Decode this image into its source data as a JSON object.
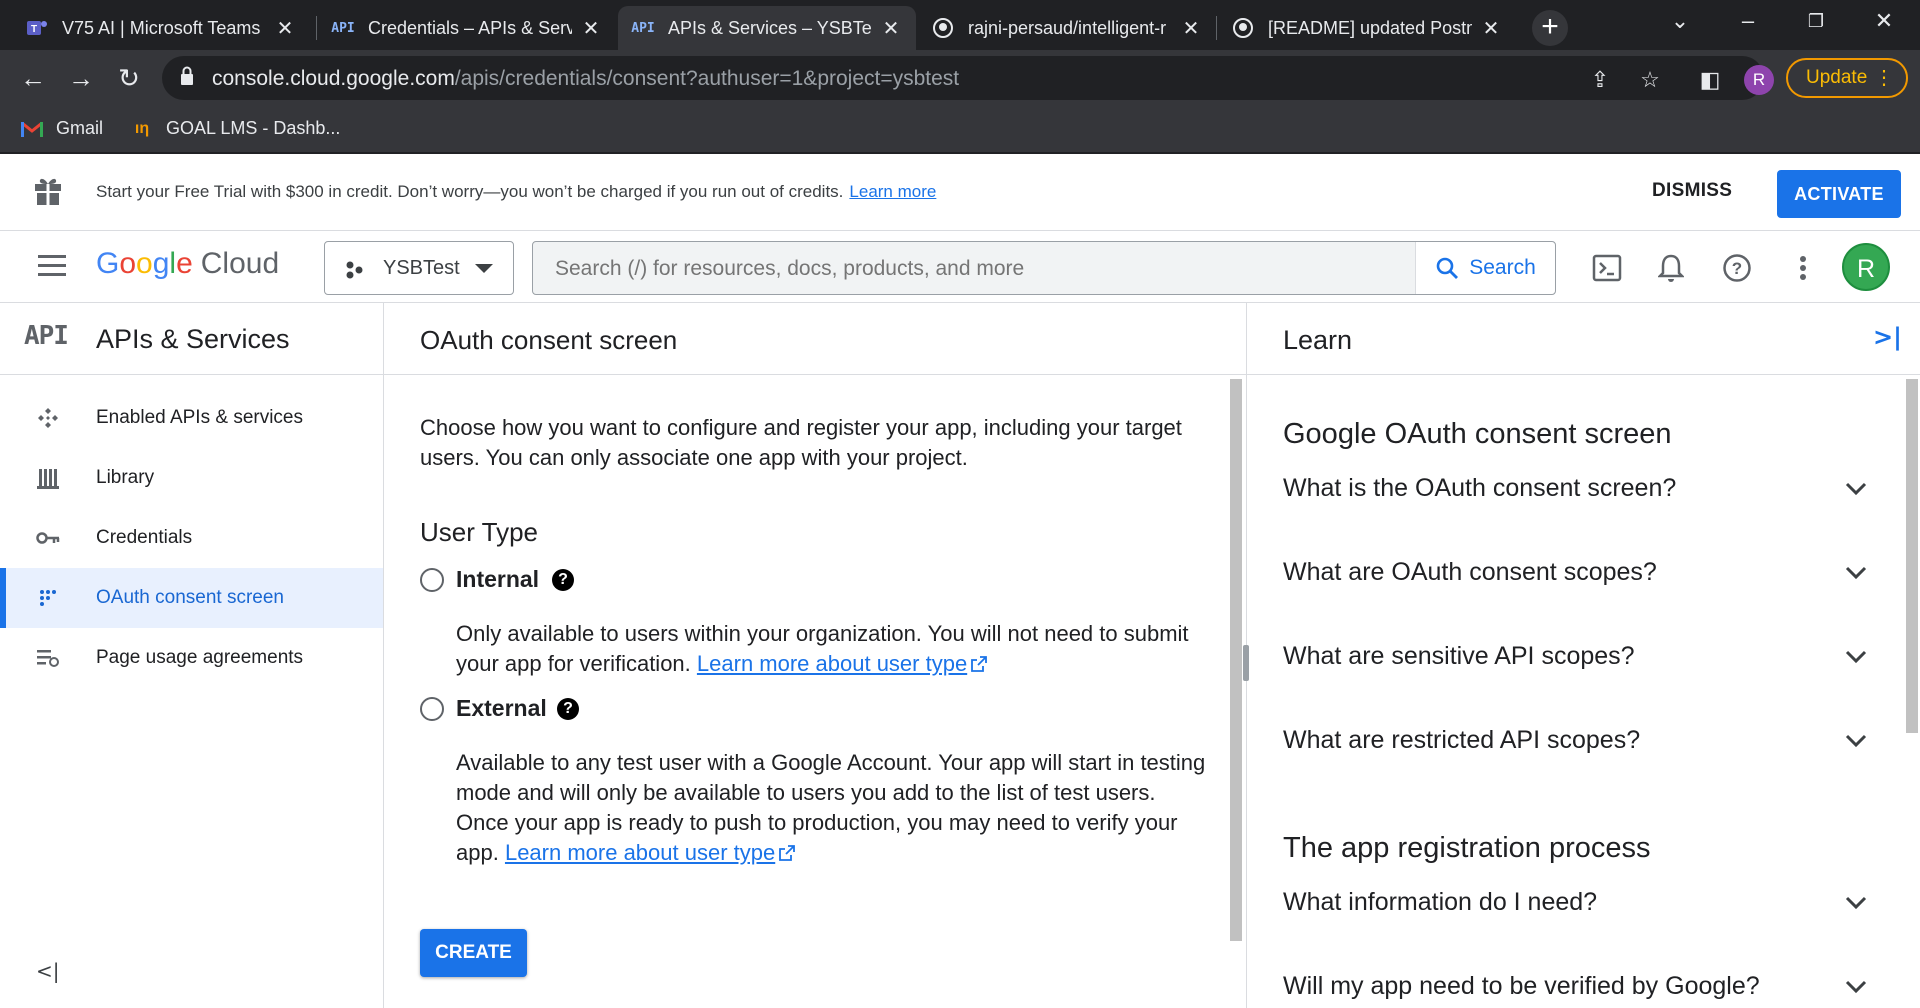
{
  "browser": {
    "tabs": [
      {
        "title": "V75 AI | Microsoft Teams",
        "icon": "teams-icon",
        "active": false
      },
      {
        "title": "Credentials – APIs & Servi",
        "icon": "api-icon",
        "active": false
      },
      {
        "title": "APIs & Services – YSBTest",
        "icon": "api-icon",
        "active": true
      },
      {
        "title": "rajni-persaud/intelligent-r",
        "icon": "github-icon",
        "active": false
      },
      {
        "title": "[README] updated Postm",
        "icon": "github-icon",
        "active": false
      }
    ],
    "tab_api_glyph": "API",
    "url_host": "console.cloud.google.com",
    "url_path": "/apis/credentials/consent?authuser=1&project=ysbtest",
    "profile_initial": "R",
    "update_label": "Update",
    "bookmarks": [
      {
        "label": "Gmail",
        "icon": "gmail-icon"
      },
      {
        "label": "GOAL LMS - Dashb...",
        "icon": "goal-lms-icon"
      }
    ]
  },
  "trial_banner": {
    "text": "Start your Free Trial with $300 in credit. Don’t worry—you won’t be charged if you run out of credits.",
    "link": "Learn more",
    "dismiss": "DISMISS",
    "activate": "ACTIVATE"
  },
  "header": {
    "logo_google": [
      "G",
      "o",
      "o",
      "g",
      "l",
      "e"
    ],
    "logo_colors": [
      "#4285f4",
      "#ea4335",
      "#fbbc04",
      "#4285f4",
      "#34a853",
      "#ea4335"
    ],
    "logo_cloud": "Cloud",
    "project": "YSBTest",
    "search_placeholder": "Search (/) for resources, docs, products, and more",
    "search_button": "Search",
    "avatar_initial": "R"
  },
  "sidebar": {
    "api_glyph": "API",
    "title": "APIs & Services",
    "items": [
      {
        "label": "Enabled APIs & services",
        "icon": "enabled-apis-icon",
        "active": false
      },
      {
        "label": "Library",
        "icon": "library-icon",
        "active": false
      },
      {
        "label": "Credentials",
        "icon": "key-icon",
        "active": false
      },
      {
        "label": "OAuth consent screen",
        "icon": "consent-icon",
        "active": true
      },
      {
        "label": "Page usage agreements",
        "icon": "agreements-icon",
        "active": false
      }
    ]
  },
  "main": {
    "title": "OAuth consent screen",
    "intro": "Choose how you want to configure and register your app, including your target users. You can only associate one app with your project.",
    "user_type_title": "User Type",
    "options": [
      {
        "label": "Internal",
        "desc": "Only available to users within your organization. You will not need to submit your app for verification.",
        "link": "Learn more about user type"
      },
      {
        "label": "External",
        "desc": "Available to any test user with a Google Account. Your app will start in testing mode and will only be available to users you add to the list of test users. Once your app is ready to push to production, you may need to verify your app.",
        "link": "Learn more about user type"
      }
    ],
    "create_button": "CREATE"
  },
  "learn": {
    "title": "Learn",
    "sections": [
      {
        "title": "Google OAuth consent screen",
        "questions": [
          "What is the OAuth consent screen?",
          "What are OAuth consent scopes?",
          "What are sensitive API scopes?",
          "What are restricted API scopes?"
        ]
      },
      {
        "title": "The app registration process",
        "questions": [
          "What information do I need?",
          "Will my app need to be verified by Google?"
        ]
      }
    ]
  }
}
